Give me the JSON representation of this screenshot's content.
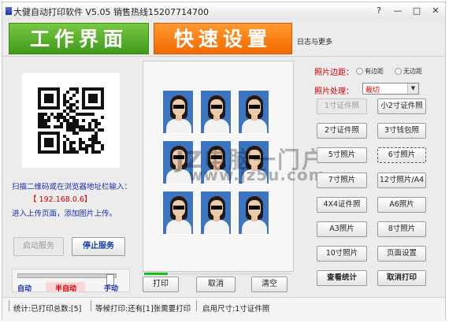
{
  "window": {
    "title": "大健自动打印软件 V5.05 销售热线15207714700",
    "controls": {
      "help": "?",
      "minimize": "—",
      "maximize": "□",
      "close": "✕"
    }
  },
  "tabs": {
    "work": "工作界面",
    "quick": "快速设置"
  },
  "log_link": "日志与更多",
  "left": {
    "scan_hint": "扫描二维码或在浏览器地址栏输入：",
    "ip": "【 192.168.0.6】",
    "upload_hint": "进入上传页面，添加图片上传。",
    "start_service": "启动服务",
    "stop_service": "停止服务",
    "mode": {
      "auto": "自动",
      "semi": "半自动",
      "manual": "手动"
    },
    "mode_level": 0.95
  },
  "preview": {
    "print": "打印",
    "cancel": "取消",
    "clear": "清空",
    "progress": 0.16
  },
  "watermark": {
    "text": "JZ电脑一门户",
    "url": "www.jz5u.com"
  },
  "settings": {
    "margin_label": "照片边距：",
    "margin_options": [
      "有边距",
      "无边距"
    ],
    "process_label": "照片处理：",
    "process_value": "裁切",
    "sizes": [
      "1寸证件照",
      "小2寸证件照",
      "2寸证件照",
      "3寸钱包照",
      "5寸照片",
      "6寸照片",
      "7寸照片",
      "12寸照片/A4",
      "4X4证件照",
      "A6照片",
      "A3照片",
      "8寸照片",
      "10寸照片",
      "页面设置",
      "查看统计",
      "取消打印"
    ]
  },
  "status": {
    "stats": "统计:已打印总数:[5]",
    "waiting": "等候打印:还有[1]张需要打印",
    "size": "启用尺寸:1寸证件照"
  }
}
